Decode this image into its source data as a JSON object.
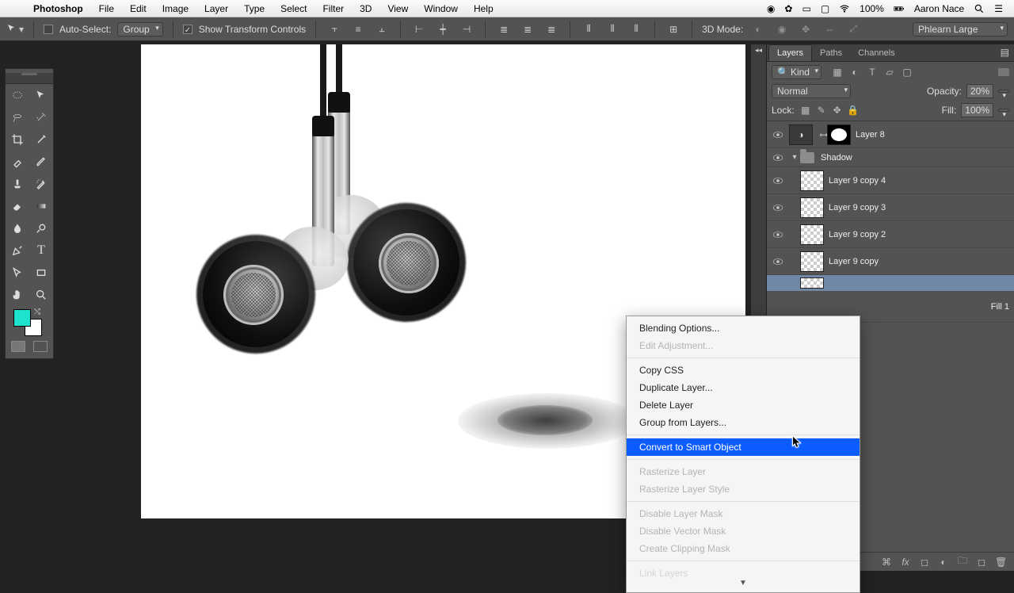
{
  "menubar": {
    "app": "Photoshop",
    "items": [
      "File",
      "Edit",
      "Image",
      "Layer",
      "Type",
      "Select",
      "Filter",
      "3D",
      "View",
      "Window",
      "Help"
    ],
    "battery_pct": "100%",
    "user": "Aaron Nace"
  },
  "options": {
    "auto_select_label": "Auto-Select:",
    "auto_select_target": "Group",
    "show_transform": "Show Transform Controls",
    "mode3d": "3D Mode:",
    "workspace": "Phlearn Large"
  },
  "swatch_fg": "#20e0d0",
  "layers_panel": {
    "tabs": [
      "Layers",
      "Paths",
      "Channels"
    ],
    "kind_label": "Kind",
    "blend_mode": "Normal",
    "opacity_label": "Opacity:",
    "opacity_value": "20%",
    "lock_label": "Lock:",
    "fill_label": "Fill:",
    "fill_value": "100%",
    "layers": [
      {
        "name": "Layer 8",
        "type": "adj_mask"
      },
      {
        "name": "Shadow",
        "type": "group"
      },
      {
        "name": "Layer 9 copy 4",
        "type": "layer",
        "indent": 1
      },
      {
        "name": "Layer 9 copy 3",
        "type": "layer",
        "indent": 1
      },
      {
        "name": "Layer 9 copy 2",
        "type": "layer",
        "indent": 1
      },
      {
        "name": "Layer 9 copy",
        "type": "layer",
        "indent": 1
      },
      {
        "name": "Fill 1",
        "type": "fill",
        "indent": 1,
        "partial": true
      }
    ]
  },
  "context_menu": {
    "items": [
      {
        "label": "Blending Options...",
        "enabled": true
      },
      {
        "label": "Edit Adjustment...",
        "enabled": false
      },
      {
        "sep": true
      },
      {
        "label": "Copy CSS",
        "enabled": true
      },
      {
        "label": "Duplicate Layer...",
        "enabled": true
      },
      {
        "label": "Delete Layer",
        "enabled": true
      },
      {
        "label": "Group from Layers...",
        "enabled": true
      },
      {
        "sep": true
      },
      {
        "label": "Convert to Smart Object",
        "enabled": true,
        "highlight": true
      },
      {
        "sep": true
      },
      {
        "label": "Rasterize Layer",
        "enabled": false
      },
      {
        "label": "Rasterize Layer Style",
        "enabled": false
      },
      {
        "sep": true
      },
      {
        "label": "Disable Layer Mask",
        "enabled": false
      },
      {
        "label": "Disable Vector Mask",
        "enabled": false
      },
      {
        "label": "Create Clipping Mask",
        "enabled": false
      },
      {
        "sep": true
      },
      {
        "label": "Link Layers",
        "enabled": false,
        "cut": true
      }
    ]
  }
}
